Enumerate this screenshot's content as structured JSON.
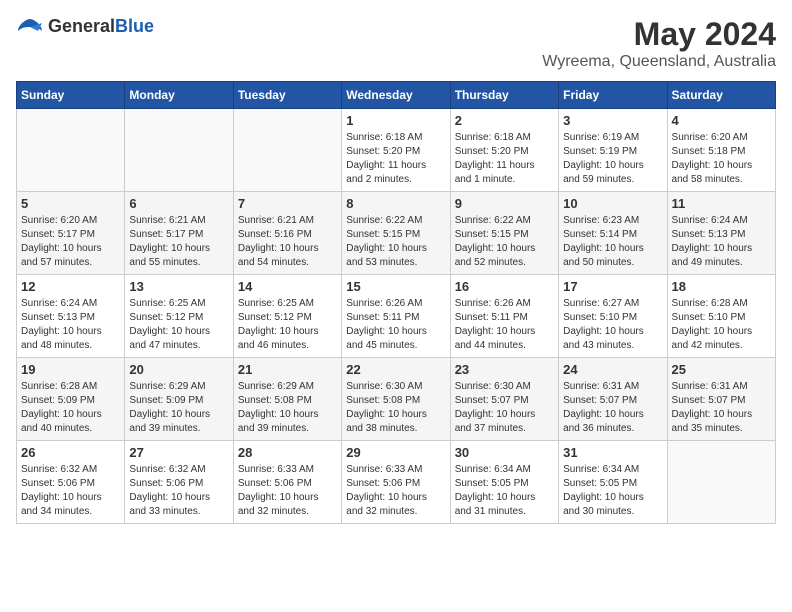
{
  "header": {
    "logo_general": "General",
    "logo_blue": "Blue",
    "month_year": "May 2024",
    "location": "Wyreema, Queensland, Australia"
  },
  "days_of_week": [
    "Sunday",
    "Monday",
    "Tuesday",
    "Wednesday",
    "Thursday",
    "Friday",
    "Saturday"
  ],
  "weeks": [
    [
      {
        "day": "",
        "info": ""
      },
      {
        "day": "",
        "info": ""
      },
      {
        "day": "",
        "info": ""
      },
      {
        "day": "1",
        "info": "Sunrise: 6:18 AM\nSunset: 5:20 PM\nDaylight: 11 hours\nand 2 minutes."
      },
      {
        "day": "2",
        "info": "Sunrise: 6:18 AM\nSunset: 5:20 PM\nDaylight: 11 hours\nand 1 minute."
      },
      {
        "day": "3",
        "info": "Sunrise: 6:19 AM\nSunset: 5:19 PM\nDaylight: 10 hours\nand 59 minutes."
      },
      {
        "day": "4",
        "info": "Sunrise: 6:20 AM\nSunset: 5:18 PM\nDaylight: 10 hours\nand 58 minutes."
      }
    ],
    [
      {
        "day": "5",
        "info": "Sunrise: 6:20 AM\nSunset: 5:17 PM\nDaylight: 10 hours\nand 57 minutes."
      },
      {
        "day": "6",
        "info": "Sunrise: 6:21 AM\nSunset: 5:17 PM\nDaylight: 10 hours\nand 55 minutes."
      },
      {
        "day": "7",
        "info": "Sunrise: 6:21 AM\nSunset: 5:16 PM\nDaylight: 10 hours\nand 54 minutes."
      },
      {
        "day": "8",
        "info": "Sunrise: 6:22 AM\nSunset: 5:15 PM\nDaylight: 10 hours\nand 53 minutes."
      },
      {
        "day": "9",
        "info": "Sunrise: 6:22 AM\nSunset: 5:15 PM\nDaylight: 10 hours\nand 52 minutes."
      },
      {
        "day": "10",
        "info": "Sunrise: 6:23 AM\nSunset: 5:14 PM\nDaylight: 10 hours\nand 50 minutes."
      },
      {
        "day": "11",
        "info": "Sunrise: 6:24 AM\nSunset: 5:13 PM\nDaylight: 10 hours\nand 49 minutes."
      }
    ],
    [
      {
        "day": "12",
        "info": "Sunrise: 6:24 AM\nSunset: 5:13 PM\nDaylight: 10 hours\nand 48 minutes."
      },
      {
        "day": "13",
        "info": "Sunrise: 6:25 AM\nSunset: 5:12 PM\nDaylight: 10 hours\nand 47 minutes."
      },
      {
        "day": "14",
        "info": "Sunrise: 6:25 AM\nSunset: 5:12 PM\nDaylight: 10 hours\nand 46 minutes."
      },
      {
        "day": "15",
        "info": "Sunrise: 6:26 AM\nSunset: 5:11 PM\nDaylight: 10 hours\nand 45 minutes."
      },
      {
        "day": "16",
        "info": "Sunrise: 6:26 AM\nSunset: 5:11 PM\nDaylight: 10 hours\nand 44 minutes."
      },
      {
        "day": "17",
        "info": "Sunrise: 6:27 AM\nSunset: 5:10 PM\nDaylight: 10 hours\nand 43 minutes."
      },
      {
        "day": "18",
        "info": "Sunrise: 6:28 AM\nSunset: 5:10 PM\nDaylight: 10 hours\nand 42 minutes."
      }
    ],
    [
      {
        "day": "19",
        "info": "Sunrise: 6:28 AM\nSunset: 5:09 PM\nDaylight: 10 hours\nand 40 minutes."
      },
      {
        "day": "20",
        "info": "Sunrise: 6:29 AM\nSunset: 5:09 PM\nDaylight: 10 hours\nand 39 minutes."
      },
      {
        "day": "21",
        "info": "Sunrise: 6:29 AM\nSunset: 5:08 PM\nDaylight: 10 hours\nand 39 minutes."
      },
      {
        "day": "22",
        "info": "Sunrise: 6:30 AM\nSunset: 5:08 PM\nDaylight: 10 hours\nand 38 minutes."
      },
      {
        "day": "23",
        "info": "Sunrise: 6:30 AM\nSunset: 5:07 PM\nDaylight: 10 hours\nand 37 minutes."
      },
      {
        "day": "24",
        "info": "Sunrise: 6:31 AM\nSunset: 5:07 PM\nDaylight: 10 hours\nand 36 minutes."
      },
      {
        "day": "25",
        "info": "Sunrise: 6:31 AM\nSunset: 5:07 PM\nDaylight: 10 hours\nand 35 minutes."
      }
    ],
    [
      {
        "day": "26",
        "info": "Sunrise: 6:32 AM\nSunset: 5:06 PM\nDaylight: 10 hours\nand 34 minutes."
      },
      {
        "day": "27",
        "info": "Sunrise: 6:32 AM\nSunset: 5:06 PM\nDaylight: 10 hours\nand 33 minutes."
      },
      {
        "day": "28",
        "info": "Sunrise: 6:33 AM\nSunset: 5:06 PM\nDaylight: 10 hours\nand 32 minutes."
      },
      {
        "day": "29",
        "info": "Sunrise: 6:33 AM\nSunset: 5:06 PM\nDaylight: 10 hours\nand 32 minutes."
      },
      {
        "day": "30",
        "info": "Sunrise: 6:34 AM\nSunset: 5:05 PM\nDaylight: 10 hours\nand 31 minutes."
      },
      {
        "day": "31",
        "info": "Sunrise: 6:34 AM\nSunset: 5:05 PM\nDaylight: 10 hours\nand 30 minutes."
      },
      {
        "day": "",
        "info": ""
      }
    ]
  ]
}
